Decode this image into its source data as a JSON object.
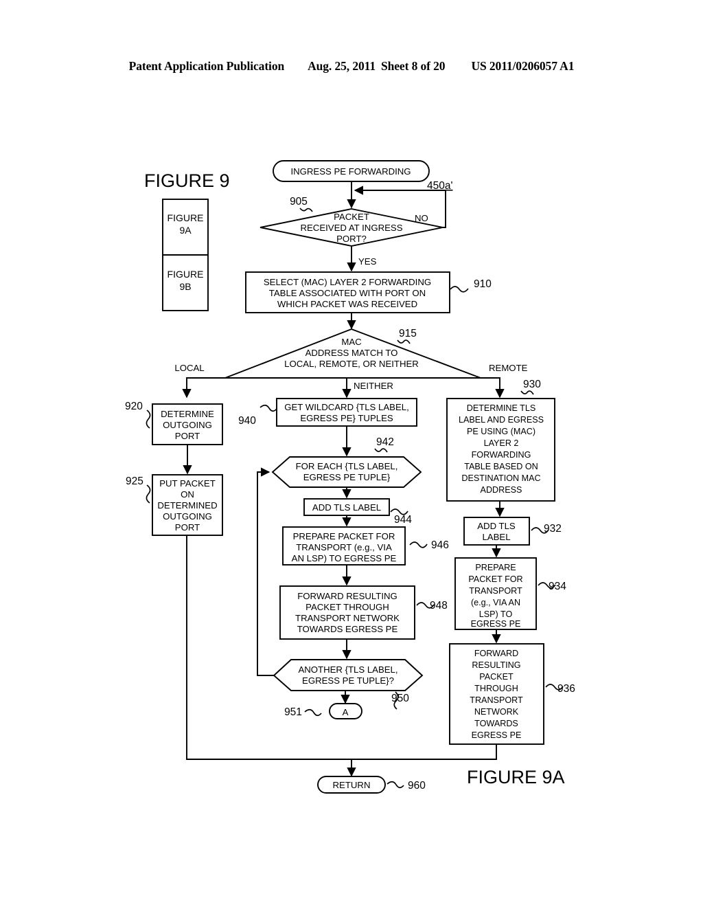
{
  "header": {
    "publication": "Patent Application Publication",
    "date": "Aug. 25, 2011",
    "sheet": "Sheet 8 of 20",
    "patent_number": "US 2011/0206057 A1"
  },
  "figure": {
    "main_title": "FIGURE 9",
    "sheet_label": "FIGURE 9A",
    "key_cells": [
      "FIGURE 9A",
      "FIGURE 9B"
    ],
    "key_cell_lines": [
      [
        "FIGURE",
        "9A"
      ],
      [
        "FIGURE",
        "9B"
      ]
    ]
  },
  "chart_data": {
    "type": "diagram",
    "title": "FIGURE 9A - INGRESS PE FORWARDING"
  },
  "nodes": {
    "start": {
      "ref": "450a'",
      "shape": "terminator",
      "lines": [
        "INGRESS PE FORWARDING"
      ]
    },
    "n905": {
      "ref": "905",
      "shape": "decision",
      "lines": [
        "PACKET",
        "RECEIVED AT INGRESS",
        "PORT?"
      ]
    },
    "n910": {
      "ref": "910",
      "shape": "process",
      "lines": [
        "SELECT (MAC) LAYER 2 FORWARDING",
        "TABLE ASSOCIATED WITH PORT ON",
        "WHICH PACKET WAS RECEIVED"
      ]
    },
    "n915": {
      "ref": "915",
      "shape": "triangle",
      "lines": [
        "MAC",
        "ADDRESS MATCH TO",
        "LOCAL, REMOTE, OR NEITHER"
      ]
    },
    "n920": {
      "ref": "920",
      "shape": "process",
      "lines": [
        "DETERMINE",
        "OUTGOING",
        "PORT"
      ]
    },
    "n925": {
      "ref": "925",
      "shape": "process",
      "lines": [
        "PUT PACKET",
        "ON",
        "DETERMINED",
        "OUTGOING",
        "PORT"
      ]
    },
    "n940": {
      "ref": "940",
      "shape": "process",
      "lines": [
        "GET WILDCARD {TLS LABEL,",
        "EGRESS PE} TUPLES"
      ]
    },
    "n942": {
      "ref": "942",
      "shape": "hexagon",
      "lines": [
        "FOR EACH {TLS LABEL,",
        "EGRESS PE TUPLE}"
      ]
    },
    "n944": {
      "ref": "944",
      "shape": "process",
      "lines": [
        "ADD TLS LABEL"
      ]
    },
    "n946": {
      "ref": "946",
      "shape": "process",
      "lines": [
        "PREPARE PACKET FOR",
        "TRANSPORT (e.g., VIA",
        "AN LSP) TO EGRESS PE"
      ]
    },
    "n948": {
      "ref": "948",
      "shape": "process",
      "lines": [
        "FORWARD RESULTING",
        "PACKET THROUGH",
        "TRANSPORT NETWORK",
        "TOWARDS EGRESS PE"
      ]
    },
    "n950": {
      "ref": "950",
      "shape": "hexagon",
      "lines": [
        "ANOTHER {TLS LABEL,",
        "EGRESS PE TUPLE}?"
      ]
    },
    "n951": {
      "ref": "951",
      "shape": "connector",
      "lines": [
        "A"
      ]
    },
    "n930": {
      "ref": "930",
      "shape": "process",
      "lines": [
        "DETERMINE TLS",
        "LABEL AND EGRESS",
        "PE USING (MAC)",
        "LAYER 2",
        "FORWARDING",
        "TABLE BASED ON",
        "DESTINATION MAC",
        "ADDRESS"
      ]
    },
    "n932": {
      "ref": "932",
      "shape": "process",
      "lines": [
        "ADD TLS",
        "LABEL"
      ]
    },
    "n934": {
      "ref": "934",
      "shape": "process",
      "lines": [
        "PREPARE",
        "PACKET FOR",
        "TRANSPORT",
        "(e.g., VIA AN",
        "LSP) TO",
        "EGRESS PE"
      ]
    },
    "n936": {
      "ref": "936",
      "shape": "process",
      "lines": [
        "FORWARD",
        "RESULTING",
        "PACKET",
        "THROUGH",
        "TRANSPORT",
        "NETWORK",
        "TOWARDS",
        "EGRESS PE"
      ]
    },
    "n960": {
      "ref": "960",
      "shape": "terminator",
      "lines": [
        "RETURN"
      ]
    }
  },
  "edge_labels": {
    "no": "NO",
    "yes": "YES",
    "local": "LOCAL",
    "neither": "NEITHER",
    "remote": "REMOTE"
  }
}
